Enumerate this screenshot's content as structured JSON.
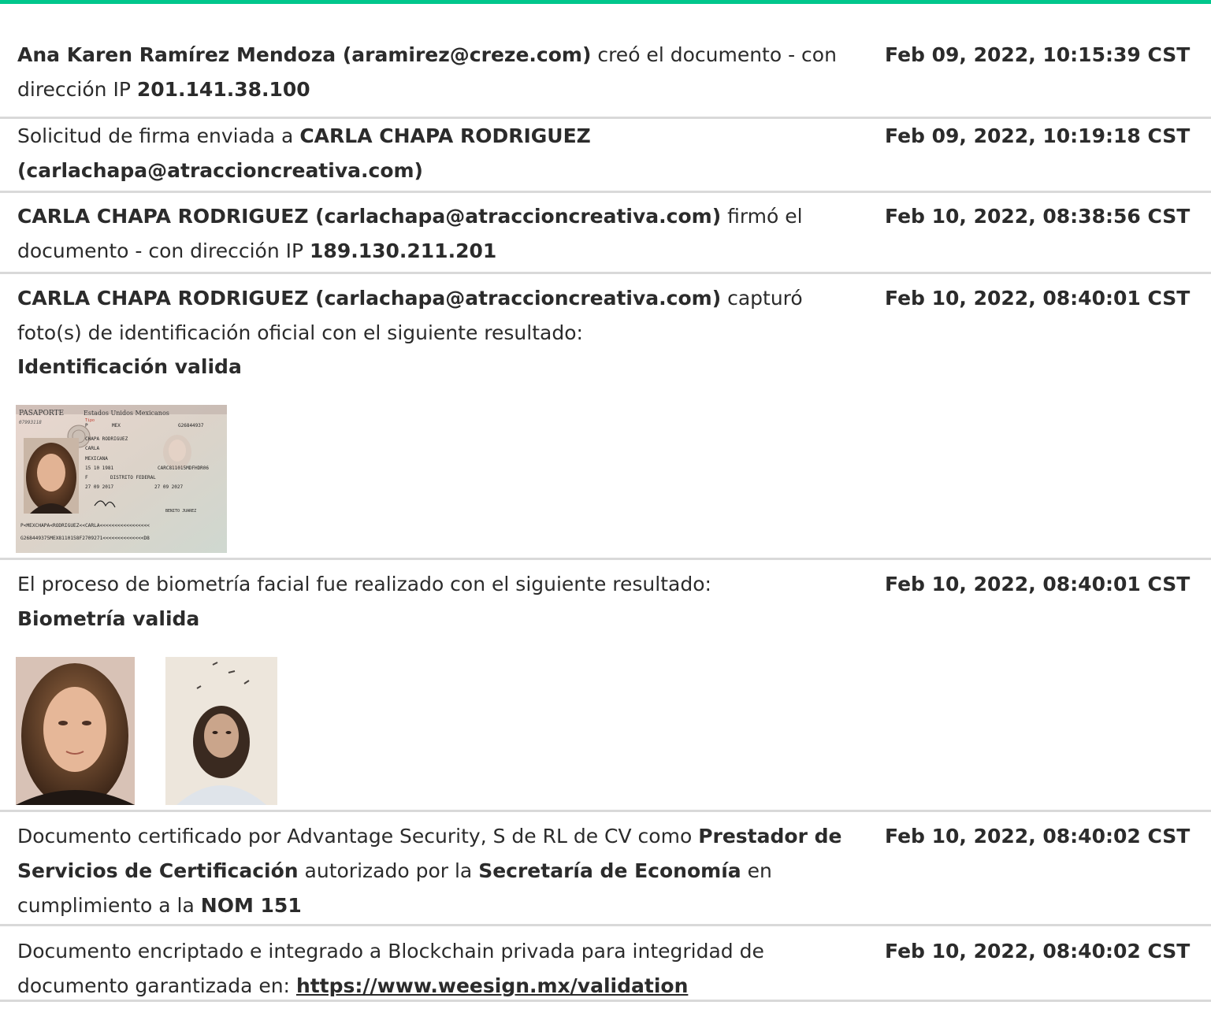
{
  "colors": {
    "accent": "#00c78c"
  },
  "events": [
    {
      "desc": [
        {
          "t": "Ana Karen Ramírez Mendoza (aramirez@creze.com)",
          "b": true
        },
        {
          "t": " creó el documento - con dirección IP "
        },
        {
          "t": "201.141.38.100",
          "b": true
        }
      ],
      "timestamp": "Feb 09, 2022, 10:15:39 CST"
    },
    {
      "desc": [
        {
          "t": "Solicitud de firma enviada a "
        },
        {
          "t": "CARLA CHAPA RODRIGUEZ (carlachapa@atraccioncreativa.com)",
          "b": true
        }
      ],
      "timestamp": "Feb 09, 2022, 10:19:18 CST"
    },
    {
      "desc": [
        {
          "t": "CARLA CHAPA RODRIGUEZ (carlachapa@atraccioncreativa.com)",
          "b": true
        },
        {
          "t": " firmó el documento - con dirección IP "
        },
        {
          "t": "189.130.211.201",
          "b": true
        }
      ],
      "timestamp": "Feb 10, 2022, 08:38:56 CST"
    },
    {
      "desc": [
        {
          "t": "CARLA CHAPA RODRIGUEZ (carlachapa@atraccioncreativa.com)",
          "b": true
        },
        {
          "t": " capturó foto(s) de identificación oficial con el siguiente resultado:"
        }
      ],
      "result": "Identificación valida",
      "timestamp": "Feb 10, 2022, 08:40:01 CST",
      "passport": {
        "header": "PASAPORTE",
        "country": "Estados Unidos Mexicanos",
        "number_small": "07993118",
        "type": "P",
        "code": "MEX",
        "passport_no": "G26844937",
        "surname": "CHAPA RODRIGUEZ",
        "given_name": "CARLA",
        "nationality": "MEXICANA",
        "birth_date": "15 10 1981",
        "curp": "CARC811015MDFHDR06",
        "sex": "F",
        "birth_place": "DISTRITO FEDERAL",
        "issue_date": "27 09 2017",
        "expiry_date": "27 09 2027",
        "authority": "BENITO JUAREZ",
        "mrz1": "P<MEXCHAPA<RODRIGUEZ<<CARLA<<<<<<<<<<<<<<<<<",
        "mrz2": "G268449375MEX8110158F2709271<<<<<<<<<<<<<<D8"
      }
    },
    {
      "desc": [
        {
          "t": "El proceso de biometría facial fue realizado con el siguiente resultado:"
        }
      ],
      "result": "Biometría valida",
      "timestamp": "Feb 10, 2022, 08:40:01 CST"
    },
    {
      "desc": [
        {
          "t": "Documento certificado por Advantage Security, S de RL de CV como "
        },
        {
          "t": "Prestador de Servicios de Certificación",
          "b": true
        },
        {
          "t": " autorizado por la "
        },
        {
          "t": "Secretaría de Economía",
          "b": true
        },
        {
          "t": " en cumplimiento a la "
        },
        {
          "t": "NOM 151",
          "b": true
        }
      ],
      "timestamp": "Feb 10, 2022, 08:40:02 CST"
    },
    {
      "desc": [
        {
          "t": "Documento encriptado e integrado a Blockchain privada para integridad de documento garantizada en: "
        },
        {
          "t": "https://www.weesign.mx/validation",
          "link": true
        }
      ],
      "timestamp": "Feb 10, 2022, 08:40:02 CST"
    }
  ]
}
